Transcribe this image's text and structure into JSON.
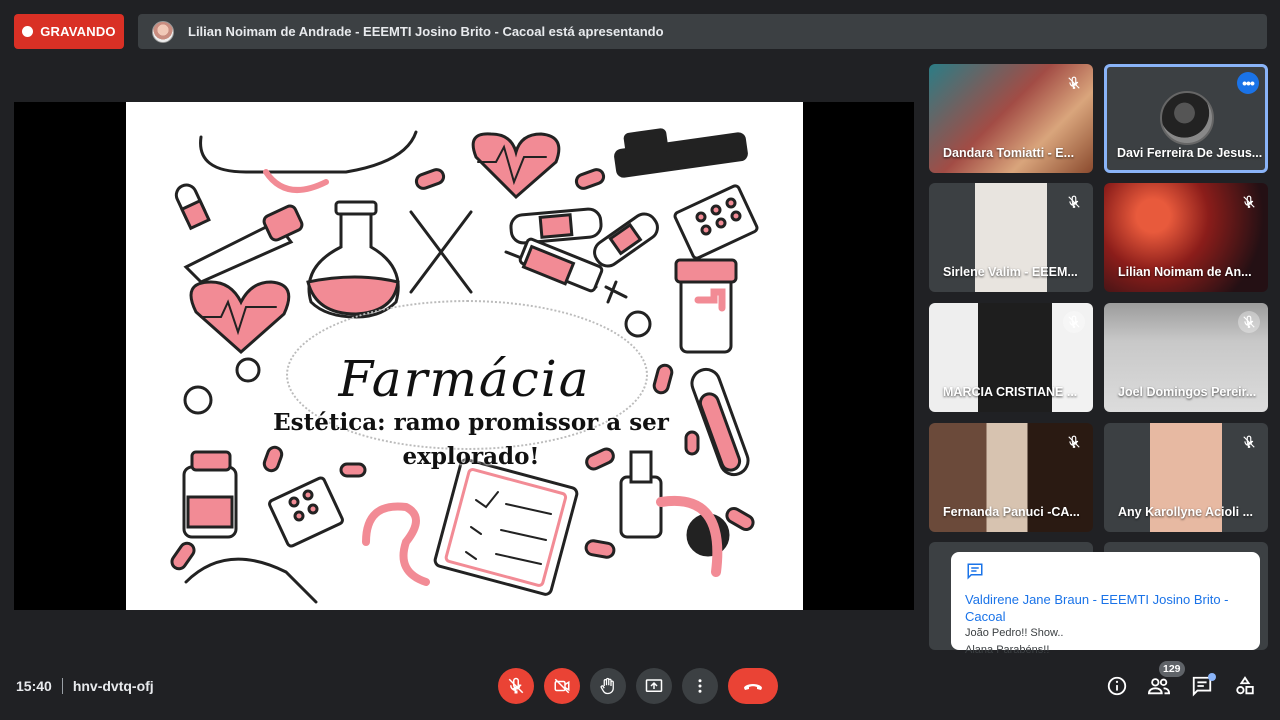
{
  "recording": {
    "label": "GRAVANDO"
  },
  "presenting": {
    "text": "Lilian Noimam de Andrade - EEEMTI Josino Brito - Cacoal está apresentando"
  },
  "slide": {
    "title": "Farmácia",
    "subtitle": "Estética: ramo promissor a ser explorado!"
  },
  "participants": [
    {
      "name": "Dandara Tomiatti - E...",
      "muted": true
    },
    {
      "name": "Davi Ferreira De Jesus...",
      "active": true
    },
    {
      "name": "Sirlene Valim - EEEM...",
      "muted": true
    },
    {
      "name": "Lilian Noimam de An...",
      "muted": true
    },
    {
      "name": "MARCIA CRISTIANE ...",
      "muted": true
    },
    {
      "name": "Joel Domingos Pereir...",
      "muted": true
    },
    {
      "name": "Fernanda Panuci -CA...",
      "muted": true
    },
    {
      "name": "Any Karollyne Acioli ...",
      "muted": true
    }
  ],
  "chat_notification": {
    "sender": "Valdirene Jane Braun - EEEMTI Josino Brito - Cacoal",
    "messages": [
      "João Pedro!! Show..",
      "Alana Parabéns!!"
    ]
  },
  "meeting": {
    "time": "15:40",
    "code": "hnv-dvtq-ofj"
  },
  "people_count": "129",
  "colors": {
    "recording": "#d93025",
    "control_red": "#ea4335",
    "accent_blue": "#8ab4f8",
    "background": "#202124",
    "slide_pink": "#f28b95"
  },
  "icons": [
    "mic-off-icon",
    "camera-off-icon",
    "raise-hand-icon",
    "present-icon",
    "more-options-icon",
    "end-call-icon",
    "info-icon",
    "people-icon",
    "chat-icon",
    "activities-icon"
  ]
}
